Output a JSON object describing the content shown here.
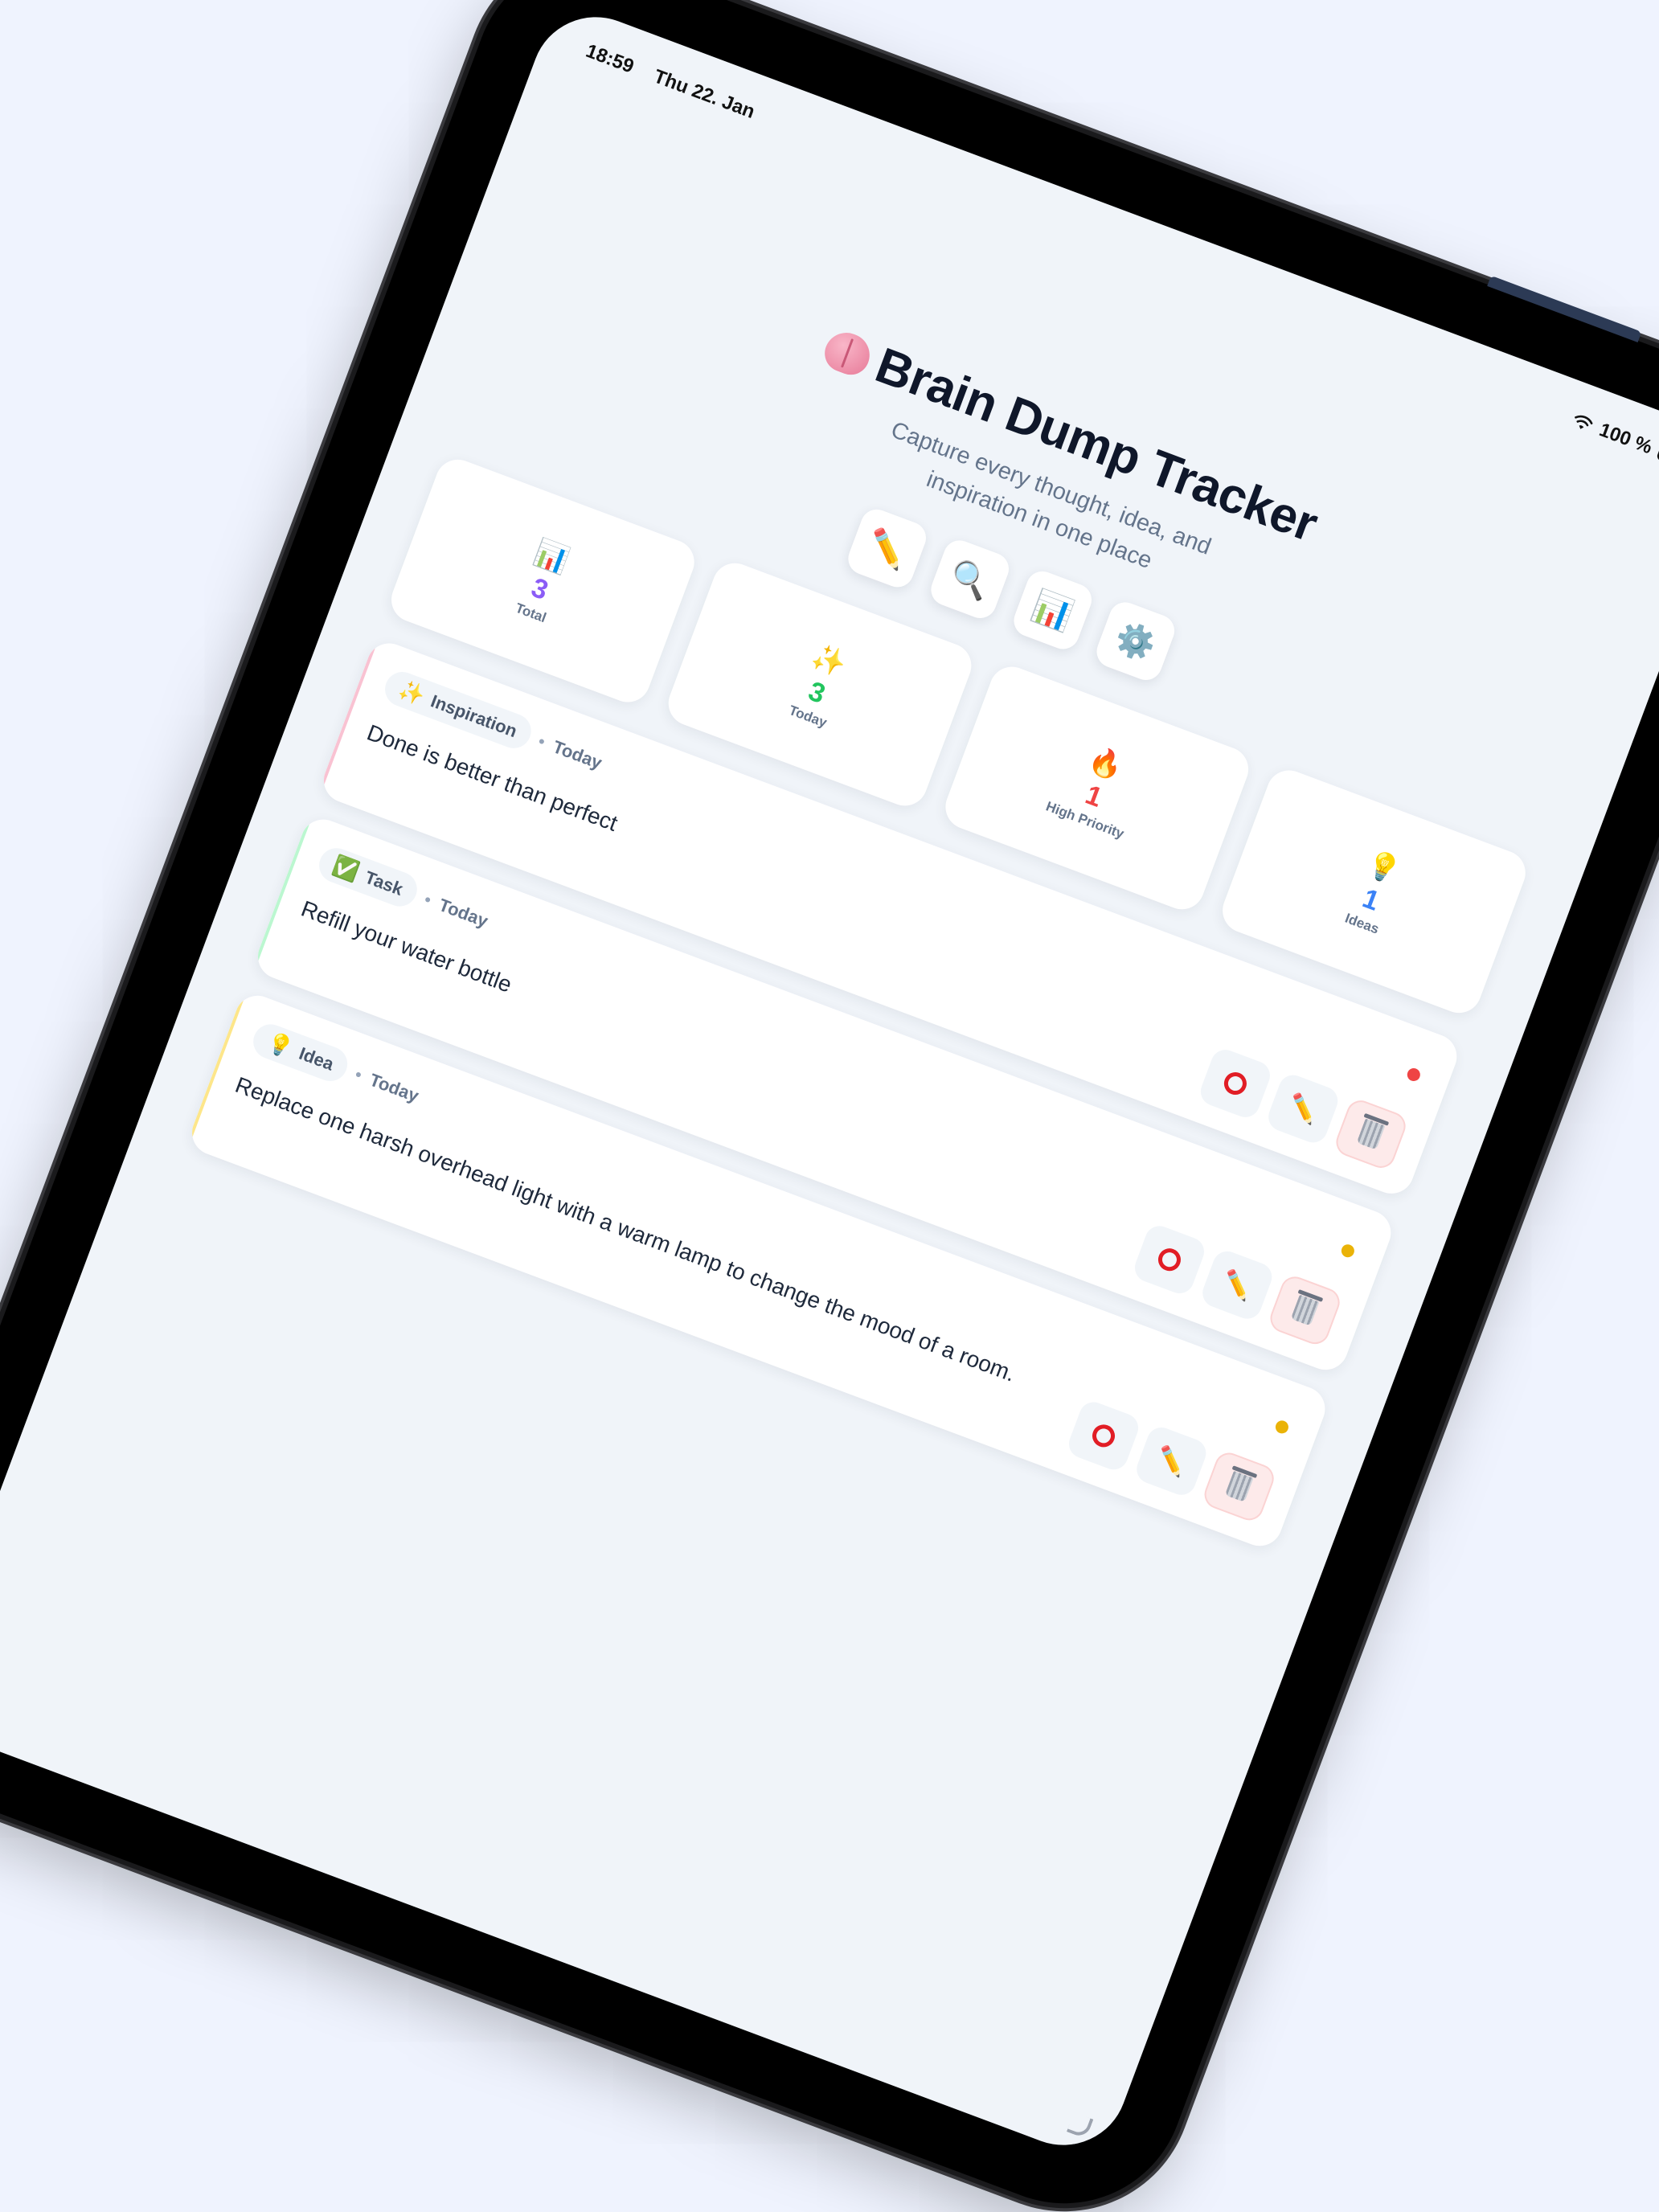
{
  "status_bar": {
    "time": "18:59",
    "date": "Thu 22. Jan",
    "battery": "100 %"
  },
  "header": {
    "title_icon": "brain-icon",
    "title": "Brain Dump Tracker",
    "subtitle_line1": "Capture every thought, idea, and",
    "subtitle_line2": "inspiration in one place"
  },
  "toolbar": [
    {
      "name": "new-entry-button",
      "icon": "pencil-icon",
      "glyph": "✏️"
    },
    {
      "name": "search-button",
      "icon": "magnifier-icon",
      "glyph": "🔍"
    },
    {
      "name": "stats-button",
      "icon": "bar-chart-icon",
      "glyph": "📊"
    },
    {
      "name": "settings-button",
      "icon": "gear-icon",
      "glyph": "⚙️"
    }
  ],
  "stats": [
    {
      "icon": "bar-chart-icon",
      "glyph": "📊",
      "value": "3",
      "label": "Total",
      "color": "#8b5cf6"
    },
    {
      "icon": "sparkles-icon",
      "glyph": "✨",
      "value": "3",
      "label": "Today",
      "color": "#22c55e"
    },
    {
      "icon": "fire-icon",
      "glyph": "🔥",
      "value": "1",
      "label": "High Priority",
      "color": "#ef4444"
    },
    {
      "icon": "lightbulb-icon",
      "glyph": "💡",
      "value": "1",
      "label": "Ideas",
      "color": "#3b82f6"
    }
  ],
  "entries": [
    {
      "category": "Inspiration",
      "category_icon": "sparkles-icon",
      "category_glyph": "✨",
      "when": "Today",
      "text": "Done is better than perfect",
      "accent_color": "#f9c2d2",
      "priority_color": "#ef4444"
    },
    {
      "category": "Task",
      "category_icon": "check-mark-icon",
      "category_glyph": "✅",
      "when": "Today",
      "text": "Refill your water bottle",
      "accent_color": "#bbf7d0",
      "priority_color": "#eab308"
    },
    {
      "category": "Idea",
      "category_icon": "lightbulb-icon",
      "category_glyph": "💡",
      "when": "Today",
      "text": "Replace one harsh overhead light with a warm lamp to change the mood of a room.",
      "accent_color": "#fde68a",
      "priority_color": "#eab308"
    }
  ],
  "entry_actions": {
    "complete_icon": "circle-icon",
    "edit_icon": "pencil-icon",
    "edit_glyph": "✏️",
    "delete_icon": "trash-icon"
  },
  "separator": "•"
}
